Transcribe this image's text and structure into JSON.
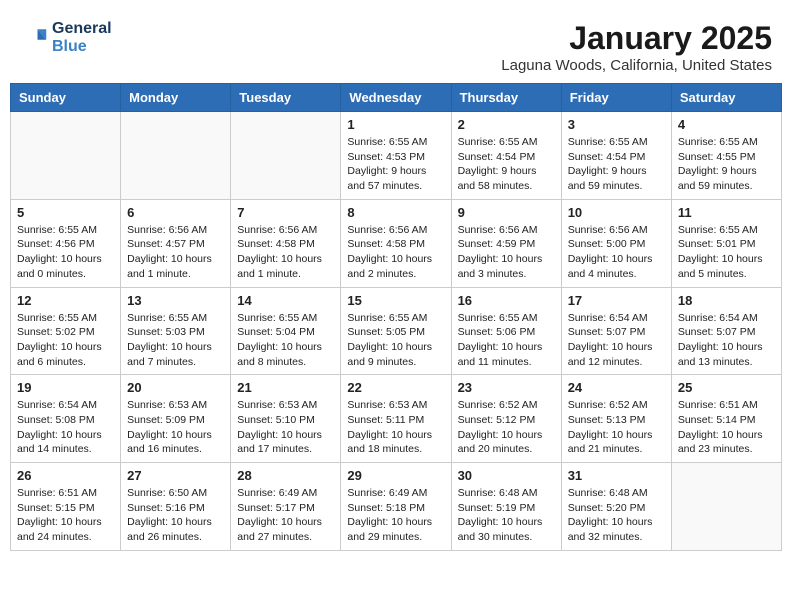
{
  "header": {
    "logo_line1": "General",
    "logo_line2": "Blue",
    "month": "January 2025",
    "location": "Laguna Woods, California, United States"
  },
  "weekdays": [
    "Sunday",
    "Monday",
    "Tuesday",
    "Wednesday",
    "Thursday",
    "Friday",
    "Saturday"
  ],
  "weeks": [
    [
      {
        "day": "",
        "info": ""
      },
      {
        "day": "",
        "info": ""
      },
      {
        "day": "",
        "info": ""
      },
      {
        "day": "1",
        "info": "Sunrise: 6:55 AM\nSunset: 4:53 PM\nDaylight: 9 hours\nand 57 minutes."
      },
      {
        "day": "2",
        "info": "Sunrise: 6:55 AM\nSunset: 4:54 PM\nDaylight: 9 hours\nand 58 minutes."
      },
      {
        "day": "3",
        "info": "Sunrise: 6:55 AM\nSunset: 4:54 PM\nDaylight: 9 hours\nand 59 minutes."
      },
      {
        "day": "4",
        "info": "Sunrise: 6:55 AM\nSunset: 4:55 PM\nDaylight: 9 hours\nand 59 minutes."
      }
    ],
    [
      {
        "day": "5",
        "info": "Sunrise: 6:55 AM\nSunset: 4:56 PM\nDaylight: 10 hours\nand 0 minutes."
      },
      {
        "day": "6",
        "info": "Sunrise: 6:56 AM\nSunset: 4:57 PM\nDaylight: 10 hours\nand 1 minute."
      },
      {
        "day": "7",
        "info": "Sunrise: 6:56 AM\nSunset: 4:58 PM\nDaylight: 10 hours\nand 1 minute."
      },
      {
        "day": "8",
        "info": "Sunrise: 6:56 AM\nSunset: 4:58 PM\nDaylight: 10 hours\nand 2 minutes."
      },
      {
        "day": "9",
        "info": "Sunrise: 6:56 AM\nSunset: 4:59 PM\nDaylight: 10 hours\nand 3 minutes."
      },
      {
        "day": "10",
        "info": "Sunrise: 6:56 AM\nSunset: 5:00 PM\nDaylight: 10 hours\nand 4 minutes."
      },
      {
        "day": "11",
        "info": "Sunrise: 6:55 AM\nSunset: 5:01 PM\nDaylight: 10 hours\nand 5 minutes."
      }
    ],
    [
      {
        "day": "12",
        "info": "Sunrise: 6:55 AM\nSunset: 5:02 PM\nDaylight: 10 hours\nand 6 minutes."
      },
      {
        "day": "13",
        "info": "Sunrise: 6:55 AM\nSunset: 5:03 PM\nDaylight: 10 hours\nand 7 minutes."
      },
      {
        "day": "14",
        "info": "Sunrise: 6:55 AM\nSunset: 5:04 PM\nDaylight: 10 hours\nand 8 minutes."
      },
      {
        "day": "15",
        "info": "Sunrise: 6:55 AM\nSunset: 5:05 PM\nDaylight: 10 hours\nand 9 minutes."
      },
      {
        "day": "16",
        "info": "Sunrise: 6:55 AM\nSunset: 5:06 PM\nDaylight: 10 hours\nand 11 minutes."
      },
      {
        "day": "17",
        "info": "Sunrise: 6:54 AM\nSunset: 5:07 PM\nDaylight: 10 hours\nand 12 minutes."
      },
      {
        "day": "18",
        "info": "Sunrise: 6:54 AM\nSunset: 5:07 PM\nDaylight: 10 hours\nand 13 minutes."
      }
    ],
    [
      {
        "day": "19",
        "info": "Sunrise: 6:54 AM\nSunset: 5:08 PM\nDaylight: 10 hours\nand 14 minutes."
      },
      {
        "day": "20",
        "info": "Sunrise: 6:53 AM\nSunset: 5:09 PM\nDaylight: 10 hours\nand 16 minutes."
      },
      {
        "day": "21",
        "info": "Sunrise: 6:53 AM\nSunset: 5:10 PM\nDaylight: 10 hours\nand 17 minutes."
      },
      {
        "day": "22",
        "info": "Sunrise: 6:53 AM\nSunset: 5:11 PM\nDaylight: 10 hours\nand 18 minutes."
      },
      {
        "day": "23",
        "info": "Sunrise: 6:52 AM\nSunset: 5:12 PM\nDaylight: 10 hours\nand 20 minutes."
      },
      {
        "day": "24",
        "info": "Sunrise: 6:52 AM\nSunset: 5:13 PM\nDaylight: 10 hours\nand 21 minutes."
      },
      {
        "day": "25",
        "info": "Sunrise: 6:51 AM\nSunset: 5:14 PM\nDaylight: 10 hours\nand 23 minutes."
      }
    ],
    [
      {
        "day": "26",
        "info": "Sunrise: 6:51 AM\nSunset: 5:15 PM\nDaylight: 10 hours\nand 24 minutes."
      },
      {
        "day": "27",
        "info": "Sunrise: 6:50 AM\nSunset: 5:16 PM\nDaylight: 10 hours\nand 26 minutes."
      },
      {
        "day": "28",
        "info": "Sunrise: 6:49 AM\nSunset: 5:17 PM\nDaylight: 10 hours\nand 27 minutes."
      },
      {
        "day": "29",
        "info": "Sunrise: 6:49 AM\nSunset: 5:18 PM\nDaylight: 10 hours\nand 29 minutes."
      },
      {
        "day": "30",
        "info": "Sunrise: 6:48 AM\nSunset: 5:19 PM\nDaylight: 10 hours\nand 30 minutes."
      },
      {
        "day": "31",
        "info": "Sunrise: 6:48 AM\nSunset: 5:20 PM\nDaylight: 10 hours\nand 32 minutes."
      },
      {
        "day": "",
        "info": ""
      }
    ]
  ]
}
